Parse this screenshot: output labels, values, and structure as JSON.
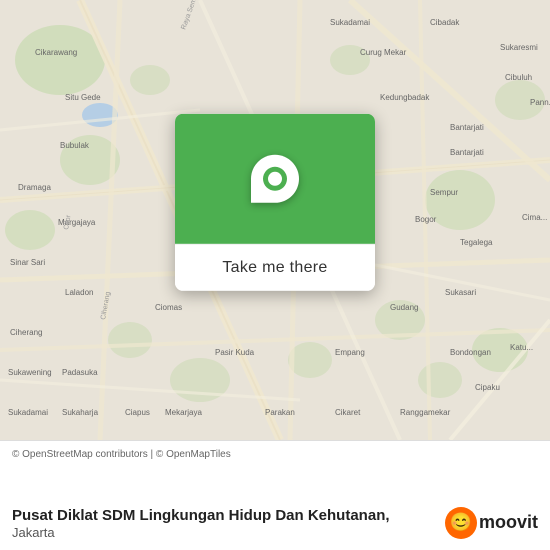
{
  "map": {
    "bg_color": "#e8e3d8",
    "card_bg_color": "#4caf50",
    "pin_color": "white"
  },
  "overlay": {
    "button_label": "Take me there"
  },
  "bottom": {
    "attribution": "© OpenStreetMap contributors | © OpenMapTiles",
    "place_name": "Pusat Diklat SDM Lingkungan Hidup Dan Kehutanan,",
    "place_city": "Jakarta",
    "moovit_label": "moovit"
  }
}
